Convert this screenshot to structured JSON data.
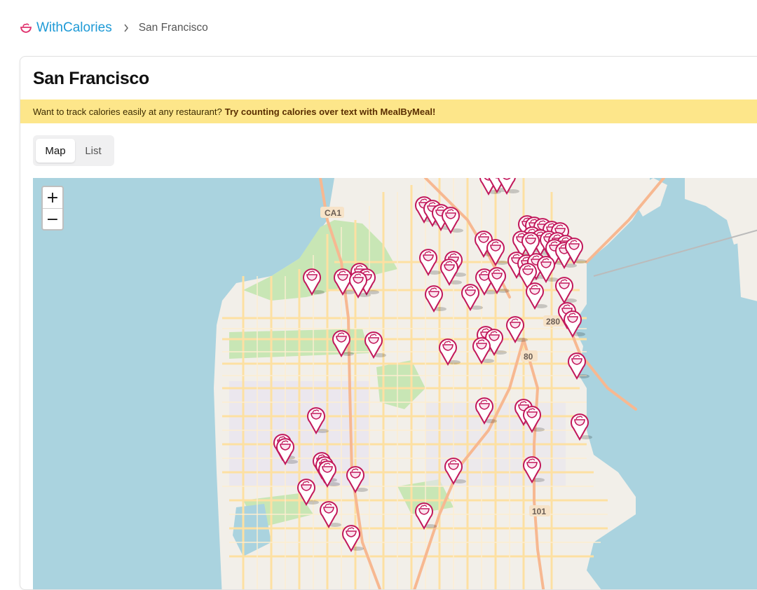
{
  "breadcrumb": {
    "brand": "WithCalories",
    "brand_icon": "bowl-icon",
    "separator_icon": "chevron-right-icon",
    "current": "San Francisco"
  },
  "page": {
    "title": "San Francisco",
    "promo_text": "Want to track calories easily at any restaurant?",
    "promo_link": "Try counting calories over text with MealByMeal!"
  },
  "tabs": [
    {
      "label": "Map",
      "active": true
    },
    {
      "label": "List",
      "active": false
    }
  ],
  "map": {
    "zoom_in": "+",
    "zoom_out": "−",
    "road_labels": [
      "CA1",
      "280",
      "80",
      "101"
    ],
    "marker_icon": "restaurant-bowl-pin-icon",
    "colors": {
      "water": "#aad3df",
      "land": "#f2efe9",
      "park": "#c8e6b5",
      "road": "#fde0a2",
      "highway": "#f7b891",
      "marker": "#c2185b",
      "brand": "#1e9ad6",
      "promo_bg": "#fde68a"
    }
  }
}
